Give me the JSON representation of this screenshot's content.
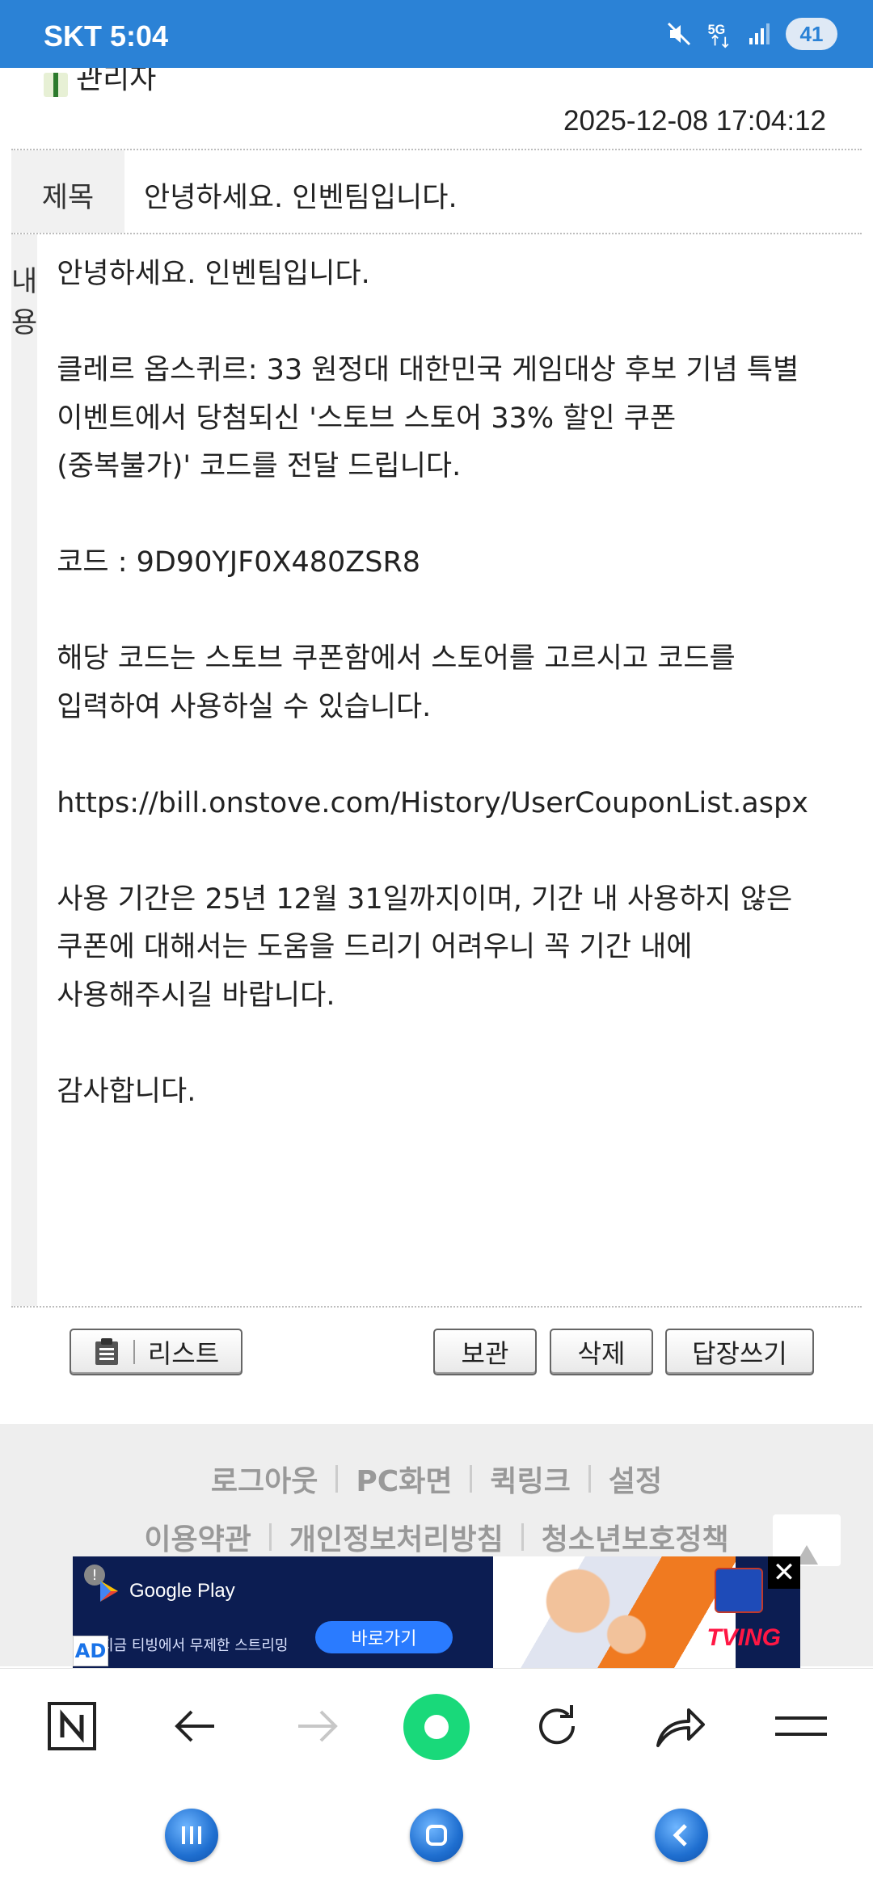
{
  "status_bar": {
    "carrier": "SKT 5:04",
    "network": "5G",
    "battery": "41",
    "icons": [
      "mute-icon",
      "5g-icon",
      "signal-icon",
      "battery-icon"
    ]
  },
  "message": {
    "author": "관리자",
    "datetime": "2025-12-08 17:04:12",
    "subject_label": "제목",
    "subject": "안녕하세요. 인벤팀입니다.",
    "content_label": "내용",
    "content": "안녕하세요. 인벤팀입니다.\n\n클레르 옵스퀴르: 33 원정대 대한민국 게임대상 후보 기념 특별 이벤트에서 당첨되신 '스토브 스토어 33% 할인 쿠폰(중복불가)' 코드를 전달 드립니다.\n\n코드 : 9D90YJF0X480ZSR8\n\n해당 코드는 스토브 쿠폰함에서 스토어를 고르시고 코드를 입력하여 사용하실 수 있습니다.\n\nhttps://bill.onstove.com/History/UserCouponList.aspx\n\n사용 기간은 25년 12월 31일까지이며, 기간 내 사용하지 않은 쿠폰에 대해서는 도움을 드리기 어려우니 꼭 기간 내에 사용해주시길 바랍니다.\n\n감사합니다."
  },
  "actions": {
    "list": "리스트",
    "keep": "보관",
    "delete": "삭제",
    "reply": "답장쓰기"
  },
  "footer": {
    "links1": [
      "로그아웃",
      "PC화면",
      "퀵링크",
      "설정"
    ],
    "links2": [
      "이용약관",
      "개인정보처리방침",
      "청소년보호정책"
    ]
  },
  "ad": {
    "store": "Google Play",
    "tagline": "지금 티빙에서 무제한 스트리밍",
    "cta": "바로가기",
    "brand": "TVING",
    "label": "AD",
    "close": "✕"
  },
  "browser_toolbar": [
    "naver-home-icon",
    "back-icon",
    "forward-icon",
    "green-dot-icon",
    "reload-icon",
    "share-icon",
    "menu-icon"
  ],
  "colors": {
    "status_bar": "#2b82d6",
    "ad_bg": "#0c1d52",
    "toolbar_green": "#19d97a"
  }
}
